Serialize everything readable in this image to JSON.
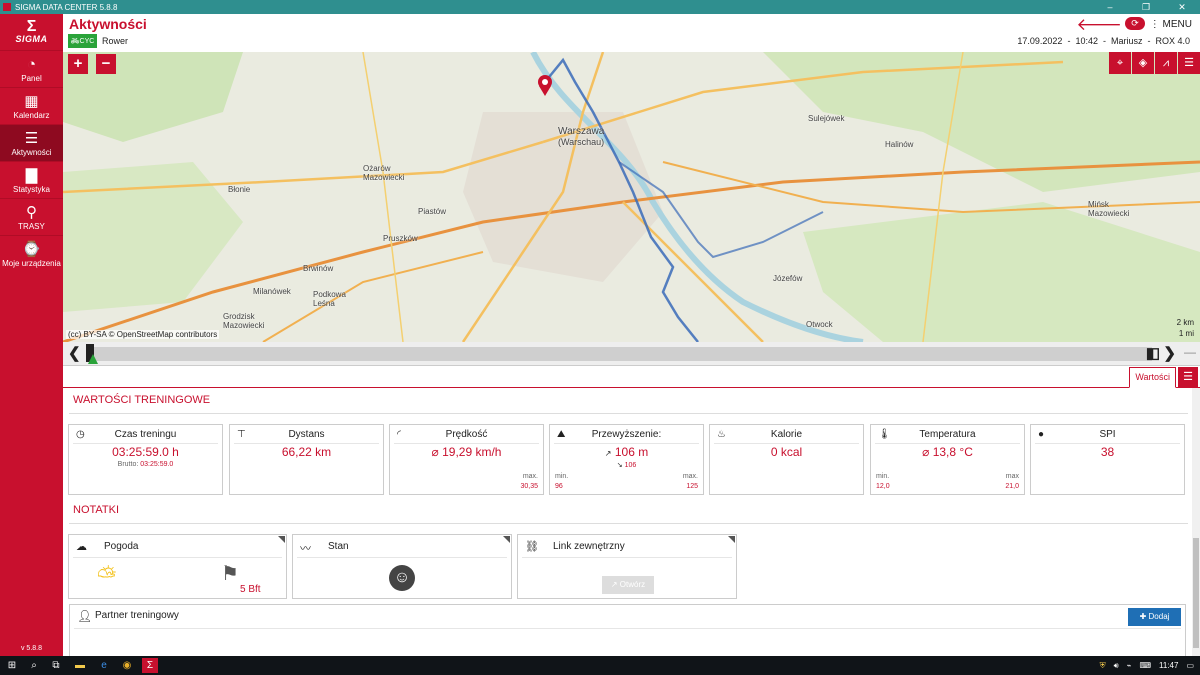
{
  "window": {
    "title": "SIGMA DATA CENTER 5.8.8",
    "controls": [
      "–",
      "❐",
      "✕"
    ]
  },
  "sidebar": {
    "logo": "SIGMA",
    "items": [
      {
        "label": "Panel",
        "icon": "gauge-icon",
        "glyph": "◔"
      },
      {
        "label": "Kalendarz",
        "icon": "calendar-icon",
        "glyph": "▦"
      },
      {
        "label": "Aktywności",
        "icon": "list-icon",
        "glyph": "☰",
        "active": true
      },
      {
        "label": "Statystyka",
        "icon": "bar-chart-icon",
        "glyph": "▇"
      },
      {
        "label": "TRASY",
        "icon": "route-pin-icon",
        "glyph": "⚲"
      },
      {
        "label": "Moje urządzenia",
        "icon": "devices-icon",
        "glyph": "⌚"
      }
    ],
    "version": "v 5.8.8"
  },
  "header": {
    "title": "Aktywności",
    "sport_badge": "CYC",
    "sport": "Rower",
    "menu_label": "MENU",
    "date": "17.09.2022",
    "time": "10:42",
    "user": "Mariusz",
    "device": "ROX 4.0",
    "colors": {
      "accent": "#c8102e",
      "sport": "#2aa33a"
    }
  },
  "map": {
    "zoom_in": "+",
    "zoom_out": "−",
    "attribution": "© OpenStreetMap contributors",
    "license_badge": "(cc) BY-SA",
    "scale_km": "2 km",
    "scale_mi": "1 mi",
    "places": [
      "Warszawa",
      "(Warschau)",
      "Sulejówek",
      "Halinów",
      "Ożarów Mazowiecki",
      "Błonie",
      "Piastów",
      "Pruszków",
      "Brwinów",
      "Milanówek",
      "Podkowa Leśna",
      "Grodzisk Mazowiecki",
      "Józefów",
      "Otwock",
      "Mińsk Mazowiecki"
    ]
  },
  "tabs": {
    "active": "Wartości"
  },
  "sections": {
    "values_title": "WARTOŚCI TRENINGOWE",
    "notes_title": "NOTATKI"
  },
  "cards": {
    "czas": {
      "label": "Czas treningu",
      "value": "03:25:59.0 h",
      "brutto_label": "Brutto:",
      "brutto_value": "03:25:59.0"
    },
    "dystans": {
      "label": "Dystans",
      "value": "66,22 km"
    },
    "predkosc": {
      "label": "Prędkość",
      "value": "⌀ 19,29 km/h",
      "max_label": "max.",
      "max_value": "30,35"
    },
    "przewyzszenie": {
      "label": "Przewyższenie:",
      "up": "106 m",
      "down": "106",
      "min_label": "min.",
      "min_value": "96",
      "max_label": "max.",
      "max_value": "125"
    },
    "kalorie": {
      "label": "Kalorie",
      "value": "0 kcal"
    },
    "temperatura": {
      "label": "Temperatura",
      "value": "⌀ 13,8 °C",
      "min_label": "min.",
      "min_value": "12,0",
      "max_label": "max",
      "max_value": "21,0"
    },
    "spi": {
      "label": "SPI",
      "value": "38"
    }
  },
  "notes": {
    "pogoda": {
      "label": "Pogoda",
      "wind": "5 Bft"
    },
    "stan": {
      "label": "Stan"
    },
    "link": {
      "label": "Link zewnętrzny",
      "button": "Otwórz"
    }
  },
  "partner": {
    "label": "Partner treningowy",
    "add_button": "Dodaj"
  },
  "taskbar": {
    "time": "11:47"
  }
}
